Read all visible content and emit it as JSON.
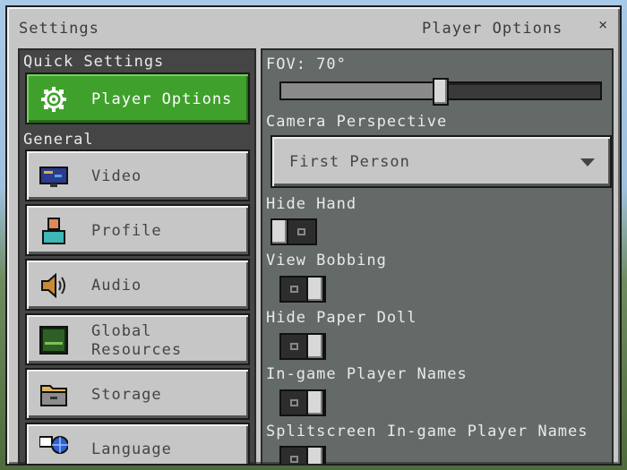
{
  "window": {
    "title": "Settings",
    "page_title": "Player Options",
    "close_symbol": "×"
  },
  "sidebar": {
    "quick_settings_label": "Quick Settings",
    "general_label": "General",
    "quick_items": [
      {
        "label": "Player Options",
        "icon": "gear-icon",
        "active": true
      }
    ],
    "general_items": [
      {
        "label": "Video",
        "icon": "monitor-icon"
      },
      {
        "label": "Profile",
        "icon": "person-icon"
      },
      {
        "label": "Audio",
        "icon": "speaker-icon"
      },
      {
        "label": "Global\nResources",
        "icon": "resource-pack-icon"
      },
      {
        "label": "Storage",
        "icon": "folder-icon"
      },
      {
        "label": "Language",
        "icon": "language-icon"
      }
    ]
  },
  "settings": {
    "fov_label": "FOV: 70°",
    "fov_value": 70,
    "fov_fraction": 0.5,
    "camera_label": "Camera Perspective",
    "camera_value": "First Person",
    "hide_hand_label": "Hide Hand",
    "hide_hand_on": false,
    "view_bobbing_label": "View Bobbing",
    "view_bobbing_on": true,
    "hide_paper_doll_label": "Hide Paper Doll",
    "hide_paper_doll_on": true,
    "ingame_names_label": "In-game Player Names",
    "ingame_names_on": true,
    "splitscreen_names_label": "Splitscreen In-game Player Names",
    "splitscreen_names_on": true
  },
  "colors": {
    "active_button": "#3fa12b",
    "button_face": "#c6c6c6"
  }
}
